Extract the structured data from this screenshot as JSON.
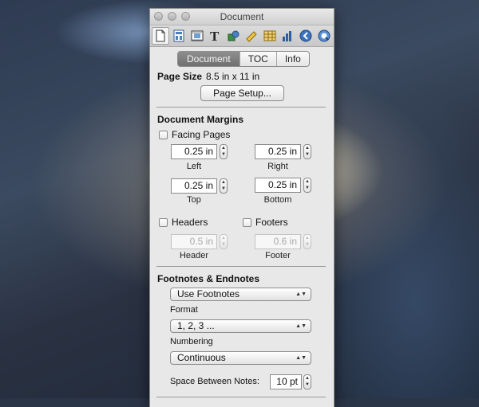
{
  "window": {
    "title": "Document"
  },
  "toolbar": {
    "icons": [
      "document-icon",
      "layout-icon",
      "wrap-icon",
      "text-icon",
      "graphic-icon",
      "ruler-icon",
      "table-icon",
      "chart-icon",
      "link-icon",
      "quicktime-icon"
    ]
  },
  "tabs": {
    "items": [
      "Document",
      "TOC",
      "Info"
    ],
    "active": "Document"
  },
  "page": {
    "size_label": "Page Size",
    "size_value": "8.5 in x 11 in",
    "setup_button": "Page Setup..."
  },
  "margins": {
    "heading": "Document Margins",
    "facing_pages": "Facing Pages",
    "left": {
      "value": "0.25 in",
      "label": "Left"
    },
    "right": {
      "value": "0.25 in",
      "label": "Right"
    },
    "top": {
      "value": "0.25 in",
      "label": "Top"
    },
    "bottom": {
      "value": "0.25 in",
      "label": "Bottom"
    },
    "headers_label": "Headers",
    "footers_label": "Footers",
    "header": {
      "value": "0.5 in",
      "label": "Header"
    },
    "footer": {
      "value": "0.6 in",
      "label": "Footer"
    }
  },
  "footnotes": {
    "heading": "Footnotes & Endnotes",
    "mode": "Use Footnotes",
    "format_label": "Format",
    "format": "1, 2, 3 ...",
    "numbering_label": "Numbering",
    "numbering": "Continuous",
    "space_label": "Space Between Notes:",
    "space_value": "10 pt"
  },
  "colors": {
    "panel": "#e8e8e8",
    "selected_tab": "#7a7a7a"
  }
}
